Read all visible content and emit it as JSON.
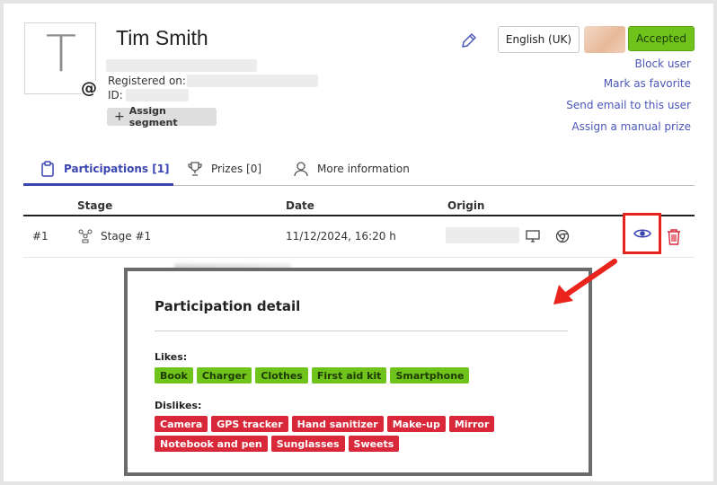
{
  "profile": {
    "avatar_letter": "T",
    "name": "Tim Smith",
    "registered_label": "Registered on:",
    "id_label": "ID:",
    "assign_segment_label": "Assign segment"
  },
  "header_actions": {
    "language": "English (UK)",
    "status": "Accepted",
    "status_color": "#6fc31a",
    "links": [
      "Block user",
      "Mark as favorite",
      "Send email to this user",
      "Assign a manual prize"
    ]
  },
  "tabs": [
    {
      "label": "Participations [1]",
      "icon": "clipboard-icon",
      "active": true
    },
    {
      "label": "Prizes [0]",
      "icon": "trophy-icon",
      "active": false
    },
    {
      "label": "More information",
      "icon": "user-icon",
      "active": false
    }
  ],
  "table": {
    "headers": [
      "Stage",
      "Date",
      "Origin"
    ],
    "rows": [
      {
        "number": "#1",
        "stage": "Stage #1",
        "date": "11/12/2024, 16:20 h"
      }
    ]
  },
  "modal": {
    "title": "Participation detail",
    "likes_label": "Likes:",
    "likes": [
      "Book",
      "Charger",
      "Clothes",
      "First aid kit",
      "Smartphone"
    ],
    "dislikes_label": "Dislikes:",
    "dislikes": [
      "Camera",
      "GPS tracker",
      "Hand sanitizer",
      "Make-up",
      "Mirror",
      "Notebook and pen",
      "Sunglasses",
      "Sweets"
    ]
  },
  "colors": {
    "accent": "#3b45b0",
    "like": "#6fc31a",
    "dislike": "#d8283a",
    "highlight": "#e8241c"
  }
}
